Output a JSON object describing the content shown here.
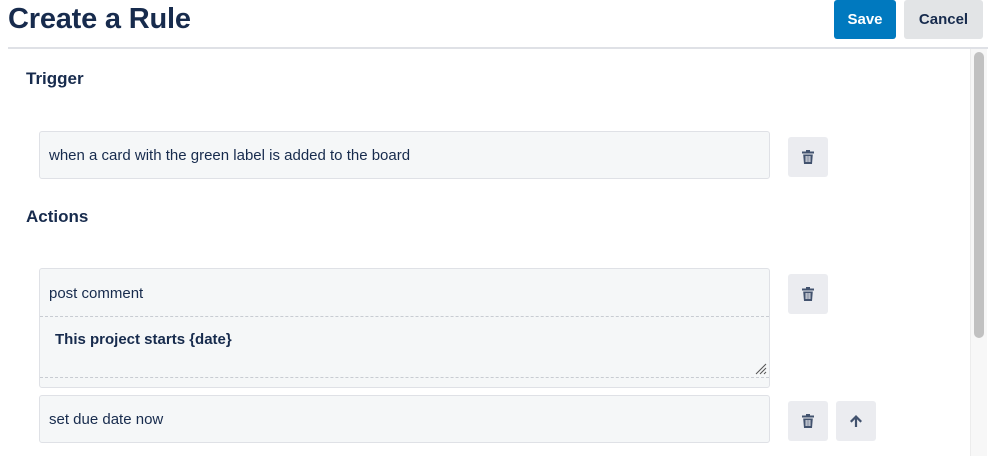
{
  "header": {
    "title": "Create a Rule",
    "save_label": "Save",
    "cancel_label": "Cancel"
  },
  "trigger": {
    "heading": "Trigger",
    "text": "when a card with the green label is added to the board"
  },
  "actions": {
    "heading": "Actions",
    "items": [
      {
        "text": "post comment",
        "comment": "This project starts {date}"
      },
      {
        "text": "set due date now"
      }
    ]
  },
  "icons": {
    "delete": "trash-icon",
    "move_up": "arrow-up-icon",
    "resize": "resize-grip-icon"
  },
  "colors": {
    "primary": "#0079bf",
    "text": "#172b4d",
    "secondary_button": "#e2e4e6"
  }
}
